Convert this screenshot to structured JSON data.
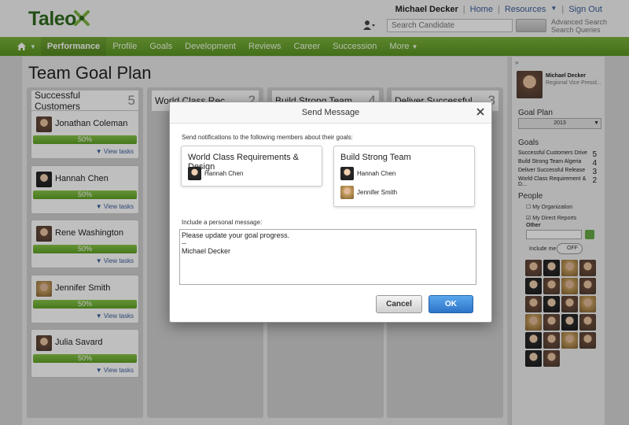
{
  "header": {
    "logo": "Taleo",
    "user": "Michael Decker",
    "links": [
      "Home",
      "Resources",
      "Sign Out"
    ],
    "search_placeholder": "Search Candidate",
    "advanced_search": "Advanced Search",
    "search_queries": "Search Queries"
  },
  "nav": {
    "items": [
      "Performance",
      "Profile",
      "Goals",
      "Development",
      "Reviews",
      "Career",
      "Succession",
      "More"
    ],
    "active": "Performance"
  },
  "page": {
    "title": "Team Goal Plan",
    "columns": [
      {
        "title": "Successful Customers",
        "count": "5"
      },
      {
        "title": "World Class Rec",
        "count": "2"
      },
      {
        "title": "Build Strong Team",
        "count": "4"
      },
      {
        "title": "Deliver Successful",
        "count": "3"
      }
    ],
    "cards": [
      {
        "name": "Jonathan Coleman",
        "progress": "50%",
        "link": "View tasks"
      },
      {
        "name": "Hannah Chen",
        "progress": "50%",
        "link": "View tasks"
      },
      {
        "name": "Rene Washington",
        "progress": "50%",
        "link": "View tasks"
      },
      {
        "name": "Jennifer Smith",
        "progress": "50%",
        "link": "View tasks"
      },
      {
        "name": "Julia Savard",
        "progress": "50%",
        "link": "View tasks"
      }
    ]
  },
  "sidebar": {
    "user": "Michael Decker",
    "role": "Regional Vice Presid...",
    "goal_plan_label": "Goal Plan",
    "goal_plan_year": "2013",
    "goals_label": "Goals",
    "goals": [
      {
        "name": "Successful Customers Drive",
        "count": "5"
      },
      {
        "name": "Build Strong Team Algeria",
        "count": "4"
      },
      {
        "name": "Deliver Successful Release",
        "count": "3"
      },
      {
        "name": "World Class Requirement & D...",
        "count": "2"
      }
    ],
    "people_label": "People",
    "my_org": "My Organization",
    "my_reports": "My Direct Reports",
    "other": "Other",
    "include_me": "Include me",
    "toggle": "OFF"
  },
  "dialog": {
    "title": "Send Message",
    "intro": "Send notifications to the following members about their goals:",
    "goal1": {
      "title": "World Class Requirements & Design",
      "members": [
        "Hannah Chen"
      ]
    },
    "goal2": {
      "title": "Build Strong Team",
      "members": [
        "Hannah Chen",
        "Jennifer Smith"
      ]
    },
    "message_label": "Include a personal message:",
    "message": "Please update your goal progress.\n--\nMichael Decker",
    "cancel": "Cancel",
    "ok": "OK"
  }
}
